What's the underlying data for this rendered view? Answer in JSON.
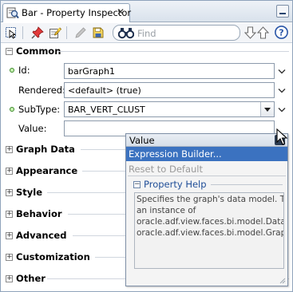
{
  "window": {
    "tab_title": "Bar - Property Inspector",
    "close_glyph": "✕"
  },
  "toolbar": {
    "search_placeholder": "Find",
    "icons": [
      "select-icon",
      "pin-icon",
      "edit-icon",
      "pencil-icon",
      "save-icon",
      "binoculars-icon",
      "arrow-down-icon",
      "arrow-up-icon",
      "help-icon"
    ]
  },
  "sections": {
    "common": {
      "label": "Common",
      "toggle": "−"
    },
    "graph_data": {
      "label": "Graph Data",
      "toggle": "+"
    },
    "appearance": {
      "label": "Appearance",
      "toggle": "+"
    },
    "style": {
      "label": "Style",
      "toggle": "+"
    },
    "behavior": {
      "label": "Behavior",
      "toggle": "+"
    },
    "advanced": {
      "label": "Advanced",
      "toggle": "+"
    },
    "customization": {
      "label": "Customization",
      "toggle": "+"
    },
    "other": {
      "label": "Other",
      "toggle": "+"
    }
  },
  "properties": {
    "id": {
      "label": "Id:",
      "value": "barGraph1"
    },
    "rendered": {
      "label": "Rendered:",
      "value": "<default> (true)"
    },
    "subtype": {
      "label": "SubType:",
      "value": "BAR_VERT_CLUST"
    },
    "value": {
      "label": "Value:",
      "value": ""
    }
  },
  "popup": {
    "title": "Value",
    "close_glyph": "✕",
    "items": [
      "Expression Builder...",
      "Reset to Default"
    ],
    "help_toggle": "−",
    "help_title": "Property Help",
    "help_text": "Specifies the graph's data model. This\nan instance of\noracle.adf.view.faces.bi.model.DataM\noracle.adf.view.faces.bi.model.Graph"
  },
  "colors": {
    "selection": "#3b72c0",
    "help_title": "#1f4e98",
    "required_dot": "#3b8a2a"
  }
}
